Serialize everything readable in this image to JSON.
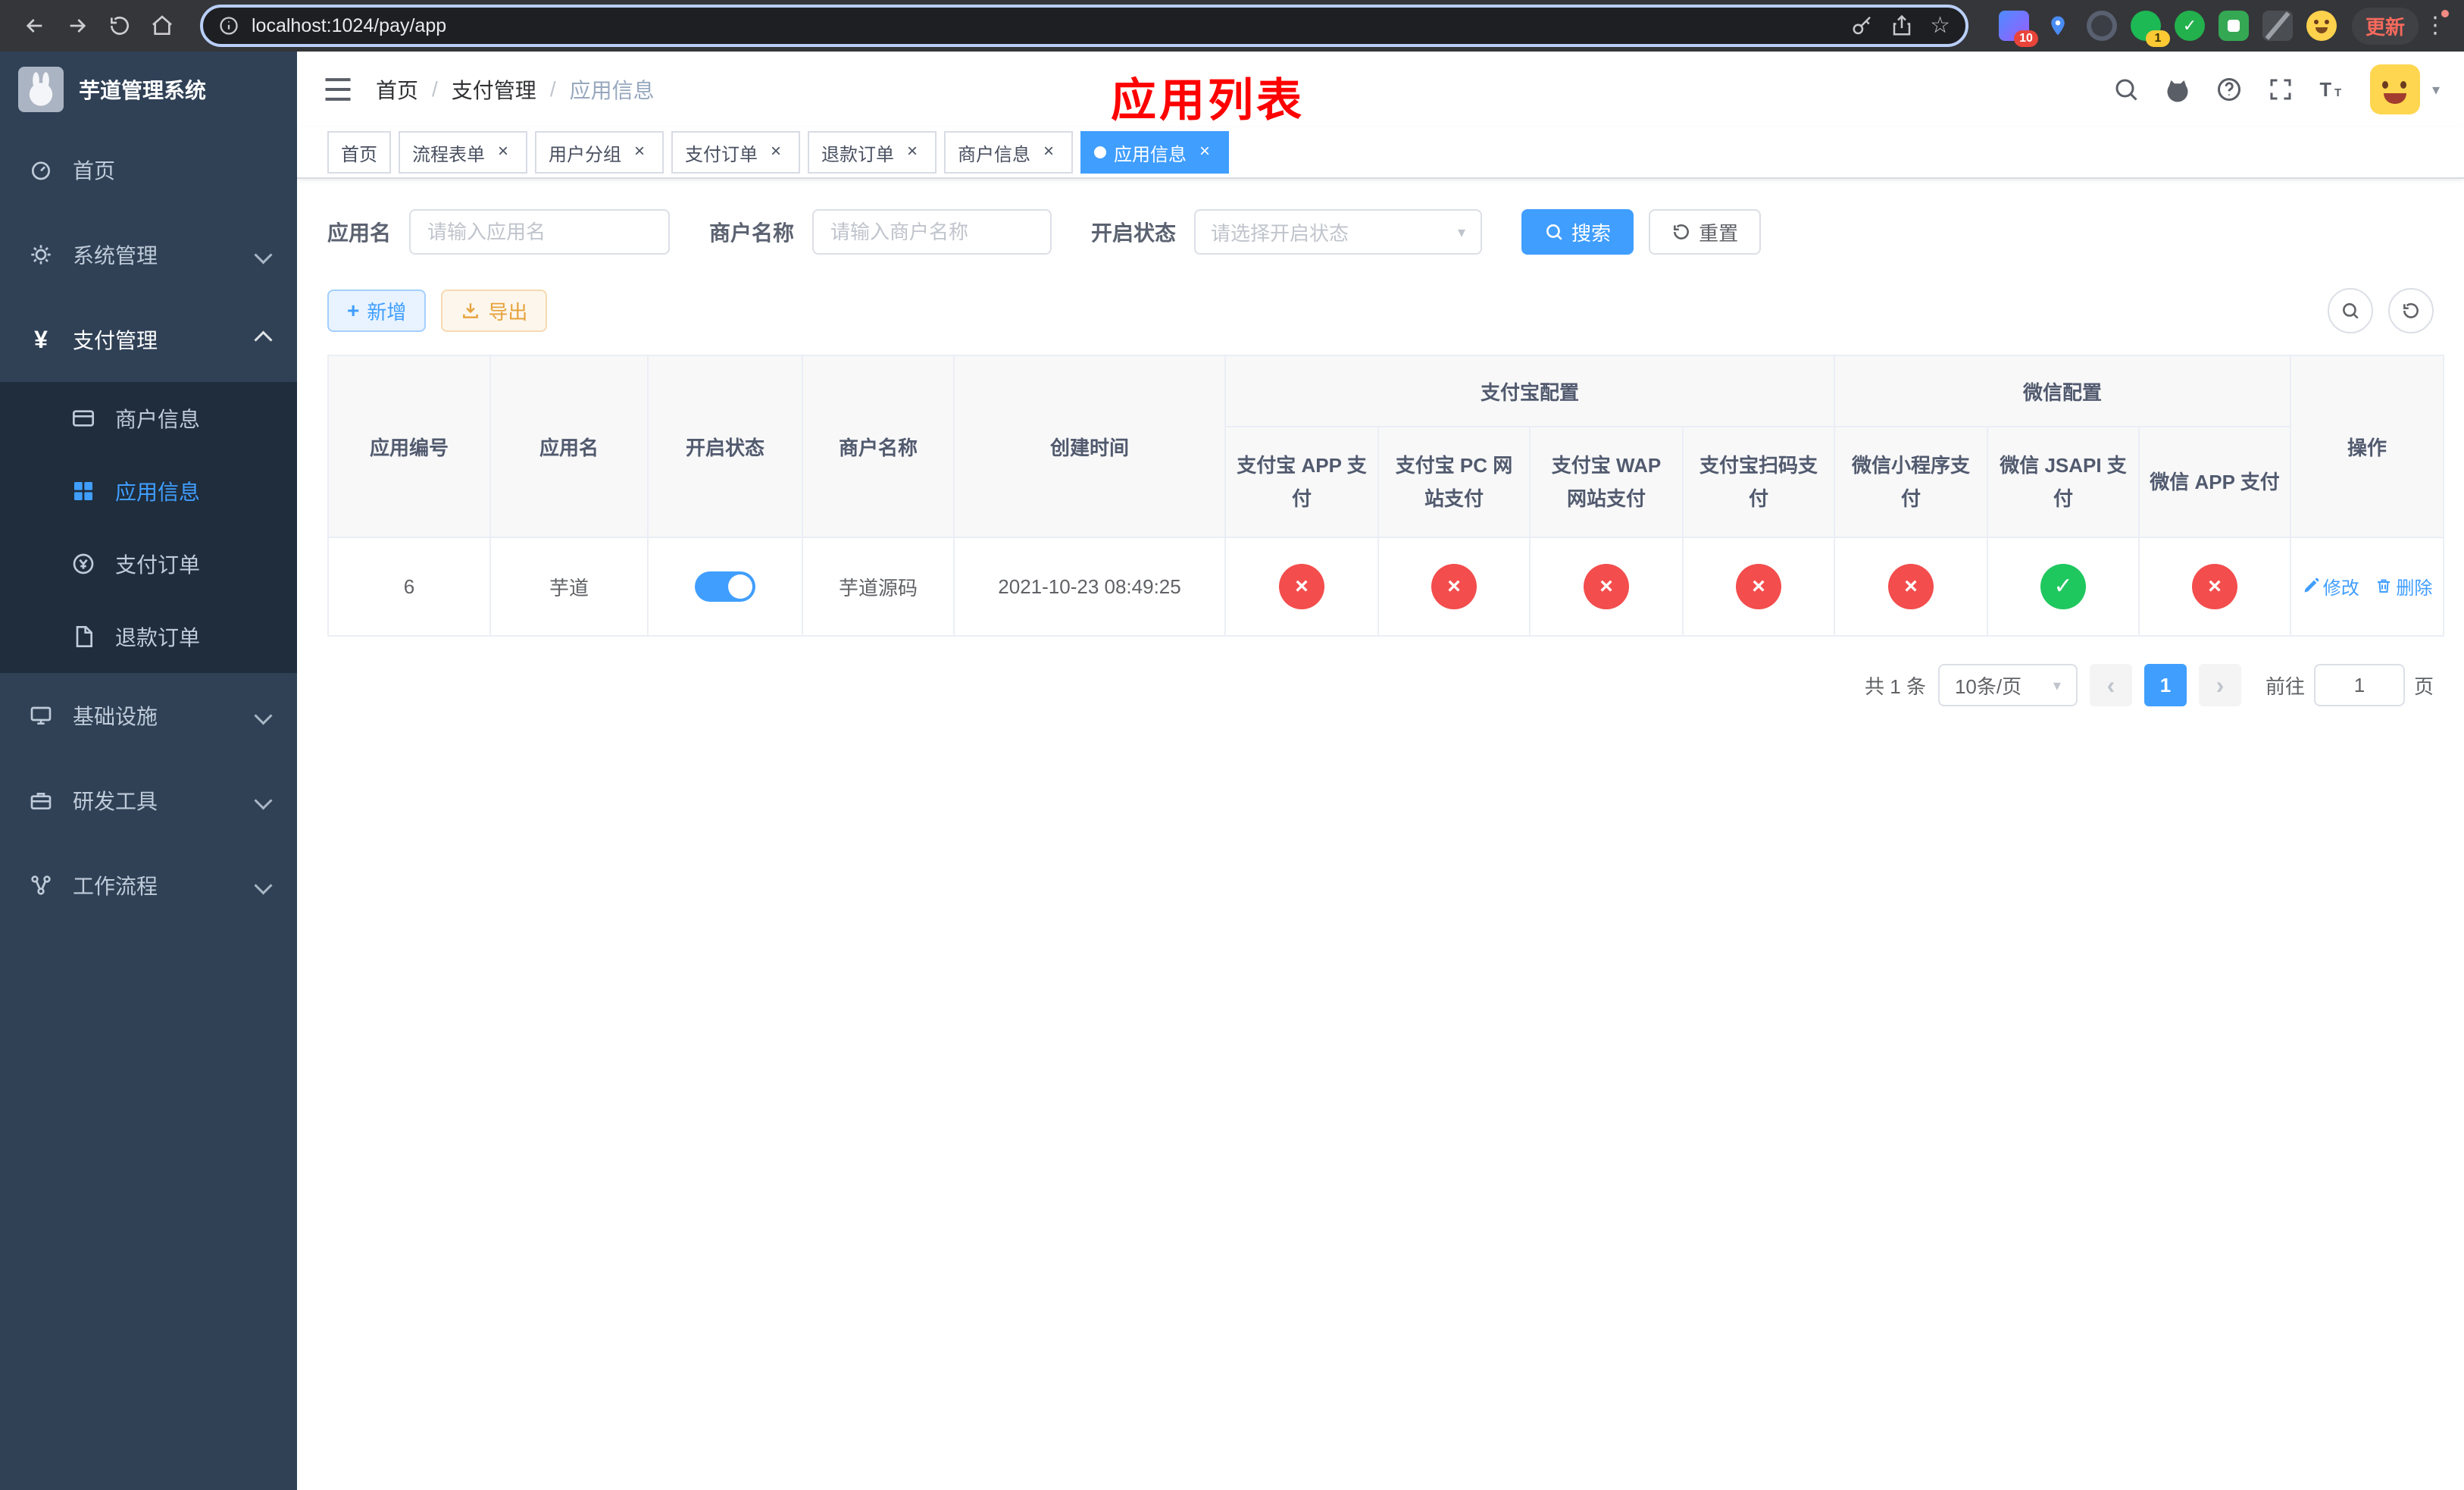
{
  "browser": {
    "url": "localhost:1024/pay/app",
    "update_label": "更新",
    "extension_badges": {
      "first": "10",
      "second": "1"
    }
  },
  "icons": {
    "close": "×",
    "check": "✓",
    "cross": "×",
    "caret_down": "▾",
    "star": "☆",
    "kebab": "⋮",
    "prev_arrow": "‹",
    "next_arrow": "›",
    "plus": "+",
    "breadcrumb_separator": "/"
  },
  "sidebar": {
    "title": "芋道管理系统",
    "items": [
      {
        "label": "首页"
      },
      {
        "label": "系统管理",
        "expandable": true
      },
      {
        "label": "支付管理",
        "expandable": true,
        "expanded": true,
        "children": [
          {
            "label": "商户信息"
          },
          {
            "label": "应用信息",
            "active": true
          },
          {
            "label": "支付订单"
          },
          {
            "label": "退款订单"
          }
        ]
      },
      {
        "label": "基础设施",
        "expandable": true
      },
      {
        "label": "研发工具",
        "expandable": true
      },
      {
        "label": "工作流程",
        "expandable": true
      }
    ]
  },
  "header": {
    "breadcrumb": [
      "首页",
      "支付管理",
      "应用信息"
    ],
    "annotation": "应用列表"
  },
  "tabs": [
    {
      "label": "首页",
      "closable": false,
      "active": false
    },
    {
      "label": "流程表单",
      "closable": true,
      "active": false
    },
    {
      "label": "用户分组",
      "closable": true,
      "active": false
    },
    {
      "label": "支付订单",
      "closable": true,
      "active": false
    },
    {
      "label": "退款订单",
      "closable": true,
      "active": false
    },
    {
      "label": "商户信息",
      "closable": true,
      "active": false
    },
    {
      "label": "应用信息",
      "closable": true,
      "active": true
    }
  ],
  "filters": {
    "app_name_label": "应用名",
    "app_name_placeholder": "请输入应用名",
    "merchant_label": "商户名称",
    "merchant_placeholder": "请输入商户名称",
    "status_label": "开启状态",
    "status_placeholder": "请选择开启状态",
    "search_label": "搜索",
    "reset_label": "重置"
  },
  "toolbar": {
    "add_label": "新增",
    "export_label": "导出"
  },
  "table": {
    "left_columns": [
      "应用编号",
      "应用名",
      "开启状态",
      "商户名称",
      "创建时间"
    ],
    "alipay_group": {
      "label": "支付宝配置",
      "columns": [
        "支付宝 APP 支付",
        "支付宝 PC 网站支付",
        "支付宝 WAP 网站支付",
        "支付宝扫码支付"
      ]
    },
    "wechat_group": {
      "label": "微信配置",
      "columns": [
        "微信小程序支付",
        "微信 JSAPI 支付",
        "微信 APP 支付"
      ]
    },
    "actions_column": "操作",
    "rows": [
      {
        "id": "6",
        "name": "芋道",
        "status_on": true,
        "merchant": "芋道源码",
        "created": "2021-10-23 08:49:25",
        "configs": [
          "no",
          "no",
          "no",
          "no",
          "no",
          "yes",
          "no"
        ],
        "edit_label": "修改",
        "delete_label": "删除"
      }
    ]
  },
  "pagination": {
    "total": "共 1 条",
    "page_size": "10条/页",
    "current_page": "1",
    "goto_prefix": "前往",
    "goto_value": "1",
    "goto_suffix": "页"
  },
  "colors": {
    "accent": "#409eff",
    "danger": "#f34d4d",
    "success": "#1fc75f",
    "warning": "#e6a23c",
    "annotation": "#fe0000",
    "sidebar_bg": "#304156",
    "submenu_bg": "#1f2d3d"
  }
}
